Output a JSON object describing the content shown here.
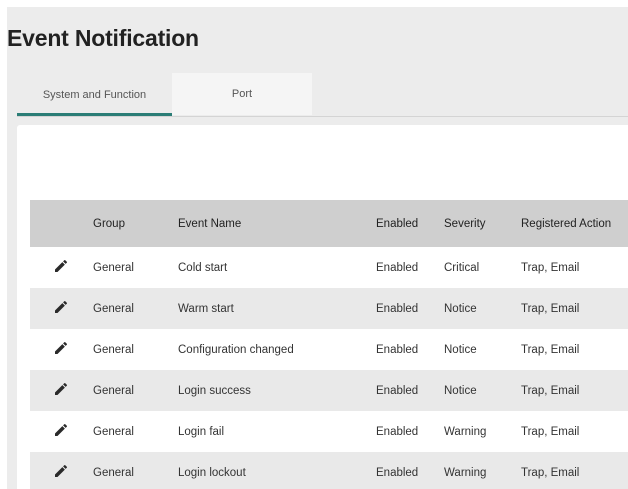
{
  "page": {
    "title": "Event Notification"
  },
  "tabs": [
    {
      "label": "System and Function",
      "active": true
    },
    {
      "label": "Port",
      "active": false
    }
  ],
  "table": {
    "columns": [
      "",
      "Group",
      "Event Name",
      "Enabled",
      "Severity",
      "Registered Action"
    ],
    "rows": [
      {
        "group": "General",
        "event": "Cold start",
        "enabled": "Enabled",
        "severity": "Critical",
        "action": "Trap, Email"
      },
      {
        "group": "General",
        "event": "Warm start",
        "enabled": "Enabled",
        "severity": "Notice",
        "action": "Trap, Email"
      },
      {
        "group": "General",
        "event": "Configuration changed",
        "enabled": "Enabled",
        "severity": "Notice",
        "action": "Trap, Email"
      },
      {
        "group": "General",
        "event": "Login success",
        "enabled": "Enabled",
        "severity": "Notice",
        "action": "Trap, Email"
      },
      {
        "group": "General",
        "event": "Login fail",
        "enabled": "Enabled",
        "severity": "Warning",
        "action": "Trap, Email"
      },
      {
        "group": "General",
        "event": "Login lockout",
        "enabled": "Enabled",
        "severity": "Warning",
        "action": "Trap, Email"
      }
    ]
  },
  "icons": {
    "row_edit": "pencil-icon"
  },
  "colors": {
    "accent": "#2b7d76",
    "header_bg": "#cfcfcf",
    "stripe_bg": "#e9e9e9"
  }
}
